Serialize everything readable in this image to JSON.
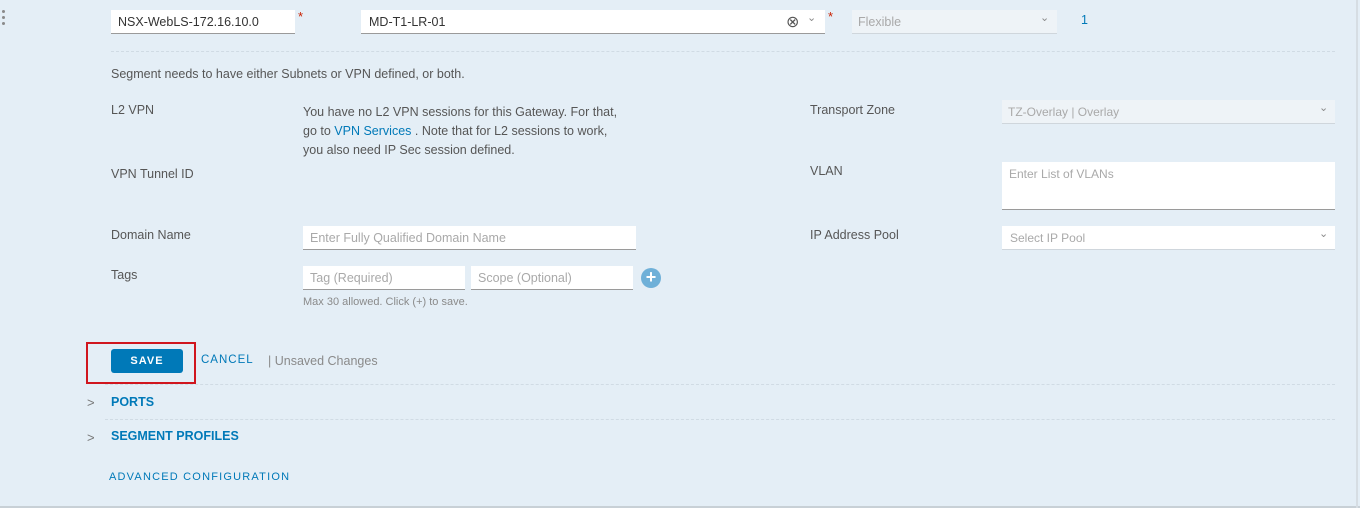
{
  "row": {
    "segment_name": "NSX-WebLS-172.16.10.0",
    "connected_gateway": "MD-T1-LR-01",
    "gateway_type": "Flexible",
    "subnet_count": "1",
    "required_marker": "*"
  },
  "notice": "Segment needs to have either Subnets or VPN defined, or both.",
  "left_form": {
    "l2vpn": {
      "label": "L2 VPN",
      "text_before": "You have no L2 VPN sessions for this Gateway. For that,",
      "text_go_to": "go to",
      "link": "VPN Services",
      "text_after": ". Note that for L2 sessions to work,",
      "text_line3": "you also need IP Sec session defined."
    },
    "vpn_tunnel_id": {
      "label": "VPN Tunnel ID"
    },
    "domain_name": {
      "label": "Domain Name",
      "placeholder": "Enter Fully Qualified Domain Name",
      "value": ""
    },
    "tags": {
      "label": "Tags",
      "tag_placeholder": "Tag (Required)",
      "scope_placeholder": "Scope (Optional)",
      "hint": "Max 30 allowed. Click (+) to save."
    }
  },
  "right_form": {
    "transport_zone": {
      "label": "Transport Zone",
      "value": "TZ-Overlay | Overlay"
    },
    "vlan": {
      "label": "VLAN",
      "placeholder": "Enter List of VLANs"
    },
    "ip_pool": {
      "label": "IP Address Pool",
      "placeholder": "Select IP Pool"
    }
  },
  "actions": {
    "save": "SAVE",
    "cancel": "CANCEL",
    "status": "| Unsaved Changes"
  },
  "sections": {
    "ports": "PORTS",
    "segment_profiles": "SEGMENT PROFILES",
    "advanced": "ADVANCED CONFIGURATION"
  },
  "icons": {
    "chevron": "⌄",
    "expand": ">",
    "clear": "⊗",
    "plus": "+"
  },
  "colors": {
    "accent": "#0079b8",
    "required": "#c92100",
    "highlight": "#d0161e",
    "background": "#e4eef6"
  }
}
